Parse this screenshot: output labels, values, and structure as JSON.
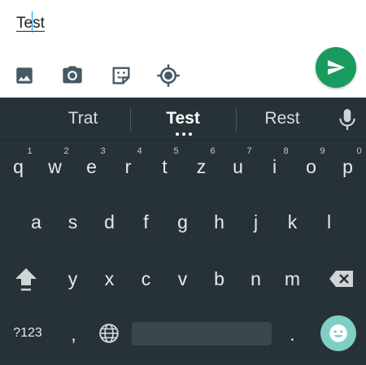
{
  "compose": {
    "message_text": "Test",
    "tools": [
      {
        "name": "gallery-icon"
      },
      {
        "name": "camera-icon"
      },
      {
        "name": "sticker-icon"
      },
      {
        "name": "location-icon"
      }
    ],
    "send_icon": "send-icon"
  },
  "keyboard": {
    "suggestions": [
      "Trat",
      "Test",
      "Rest"
    ],
    "row1": [
      "q",
      "w",
      "e",
      "r",
      "t",
      "z",
      "u",
      "i",
      "o",
      "p"
    ],
    "row1_hints": [
      "1",
      "2",
      "3",
      "4",
      "5",
      "6",
      "7",
      "8",
      "9",
      "0"
    ],
    "row2": [
      "a",
      "s",
      "d",
      "f",
      "g",
      "h",
      "j",
      "k",
      "l"
    ],
    "row3": [
      "y",
      "x",
      "c",
      "v",
      "b",
      "n",
      "m"
    ],
    "symbols_label": "?123",
    "comma": ",",
    "period": ".",
    "colors": {
      "background": "#263238",
      "send": "#1a9b5e",
      "emoji": "#7fcfc4"
    }
  }
}
